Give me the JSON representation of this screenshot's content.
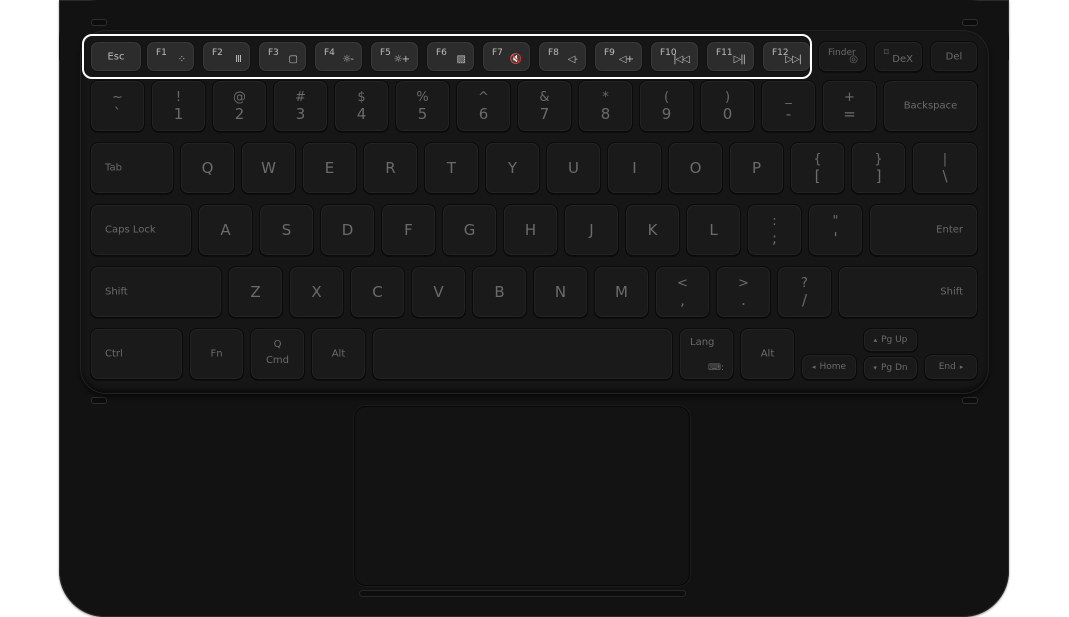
{
  "device": "Keyboard cover",
  "highlighted_group": "function-keys",
  "colors": {
    "highlight_border": "#ffffff",
    "body": "#121212",
    "key": "#1a1a1a",
    "key_highlighted": "#2c2c2c"
  },
  "rows": {
    "function": [
      {
        "id": "esc",
        "label": "Esc"
      },
      {
        "id": "f1",
        "label": "F1",
        "icon": "apps-icon",
        "glyph": "⁘"
      },
      {
        "id": "f2",
        "label": "F2",
        "icon": "recent-apps-icon",
        "glyph": "III"
      },
      {
        "id": "f3",
        "label": "F3",
        "icon": "home-icon",
        "glyph": "▢"
      },
      {
        "id": "f4",
        "label": "F4",
        "icon": "brightness-down-icon",
        "glyph": "☼-"
      },
      {
        "id": "f5",
        "label": "F5",
        "icon": "brightness-up-icon",
        "glyph": "☼+"
      },
      {
        "id": "f6",
        "label": "F6",
        "icon": "screen-off-icon",
        "glyph": "▨"
      },
      {
        "id": "f7",
        "label": "F7",
        "icon": "mute-icon",
        "glyph": "🔇"
      },
      {
        "id": "f8",
        "label": "F8",
        "icon": "volume-down-icon",
        "glyph": "◁-"
      },
      {
        "id": "f9",
        "label": "F9",
        "icon": "volume-up-icon",
        "glyph": "◁+"
      },
      {
        "id": "f10",
        "label": "F10",
        "icon": "previous-track-icon",
        "glyph": "|◁◁"
      },
      {
        "id": "f11",
        "label": "F11",
        "icon": "play-pause-icon",
        "glyph": "▷||"
      },
      {
        "id": "f12",
        "label": "F12",
        "icon": "next-track-icon",
        "glyph": "▷▷|"
      },
      {
        "id": "finder",
        "label": "Finder",
        "icon": "finder-icon",
        "glyph": "◎"
      },
      {
        "id": "dex",
        "label": "DeX",
        "icon": "dex-icon",
        "glyph": "⌑"
      },
      {
        "id": "del",
        "label": "Del"
      }
    ],
    "number": [
      {
        "up": "~",
        "dn": "`"
      },
      {
        "up": "!",
        "dn": "1"
      },
      {
        "up": "@",
        "dn": "2"
      },
      {
        "up": "#",
        "dn": "3"
      },
      {
        "up": "$",
        "dn": "4"
      },
      {
        "up": "%",
        "dn": "5"
      },
      {
        "up": "^",
        "dn": "6"
      },
      {
        "up": "&",
        "dn": "7"
      },
      {
        "up": "*",
        "dn": "8"
      },
      {
        "up": "(",
        "dn": "9"
      },
      {
        "up": ")",
        "dn": "0"
      },
      {
        "up": "_",
        "dn": "-"
      },
      {
        "up": "+",
        "dn": "="
      },
      {
        "label": "Backspace"
      }
    ],
    "qwerty": [
      {
        "label": "Tab"
      },
      {
        "label": "Q"
      },
      {
        "label": "W"
      },
      {
        "label": "E"
      },
      {
        "label": "R"
      },
      {
        "label": "T"
      },
      {
        "label": "Y"
      },
      {
        "label": "U"
      },
      {
        "label": "I"
      },
      {
        "label": "O"
      },
      {
        "label": "P"
      },
      {
        "up": "{",
        "dn": "["
      },
      {
        "up": "}",
        "dn": "]"
      },
      {
        "up": "|",
        "dn": "\\"
      }
    ],
    "home": [
      {
        "label": "Caps Lock"
      },
      {
        "label": "A"
      },
      {
        "label": "S"
      },
      {
        "label": "D"
      },
      {
        "label": "F"
      },
      {
        "label": "G"
      },
      {
        "label": "H"
      },
      {
        "label": "J"
      },
      {
        "label": "K"
      },
      {
        "label": "L"
      },
      {
        "up": ":",
        "dn": ";"
      },
      {
        "up": "\"",
        "dn": "'"
      },
      {
        "label": "Enter"
      }
    ],
    "shift": [
      {
        "label": "Shift"
      },
      {
        "label": "Z"
      },
      {
        "label": "X"
      },
      {
        "label": "C"
      },
      {
        "label": "V"
      },
      {
        "label": "B"
      },
      {
        "label": "N"
      },
      {
        "label": "M"
      },
      {
        "up": "<",
        "dn": ","
      },
      {
        "up": ">",
        "dn": "."
      },
      {
        "up": "?",
        "dn": "/"
      },
      {
        "label": "Shift"
      }
    ],
    "bottom": [
      {
        "label": "Ctrl"
      },
      {
        "label": "Fn"
      },
      {
        "label": "Cmd",
        "icon": "search-icon",
        "glyph": "Q"
      },
      {
        "label": "Alt"
      },
      {
        "label": ""
      },
      {
        "label": "Lang",
        "icon": "keyboard-icon",
        "glyph": "⌨:"
      },
      {
        "label": "Alt"
      },
      {
        "label": "Home",
        "arrow": "◂"
      },
      {
        "label": "Pg Up",
        "arrow": "▴"
      },
      {
        "label": "Pg Dn",
        "arrow": "▾"
      },
      {
        "label": "End",
        "arrow": "▸"
      }
    ]
  }
}
